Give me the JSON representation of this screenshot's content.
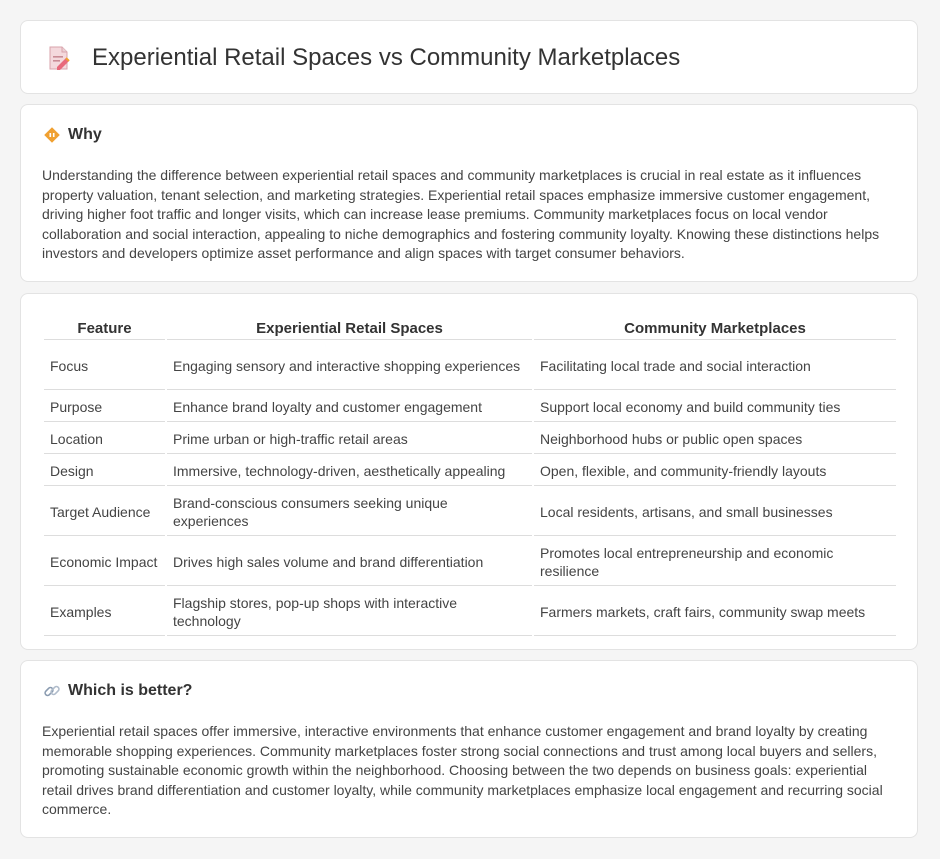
{
  "header": {
    "title": "Experiential Retail Spaces vs Community Marketplaces",
    "icon": "document-pencil-icon"
  },
  "why": {
    "heading": "Why",
    "icon": "diamond-sign-icon",
    "text": "Understanding the difference between experiential retail spaces and community marketplaces is crucial in real estate as it influences property valuation, tenant selection, and marketing strategies. Experiential retail spaces emphasize immersive customer engagement, driving higher foot traffic and longer visits, which can increase lease premiums. Community marketplaces focus on local vendor collaboration and social interaction, appealing to niche demographics and fostering community loyalty. Knowing these distinctions helps investors and developers optimize asset performance and align spaces with target consumer behaviors."
  },
  "comparison": {
    "headers": [
      "Feature",
      "Experiential Retail Spaces",
      "Community Marketplaces"
    ],
    "rows": [
      [
        "Focus",
        "Engaging sensory and interactive shopping experiences",
        "Facilitating local trade and social interaction"
      ],
      [
        "Purpose",
        "Enhance brand loyalty and customer engagement",
        "Support local economy and build community ties"
      ],
      [
        "Location",
        "Prime urban or high-traffic retail areas",
        "Neighborhood hubs or public open spaces"
      ],
      [
        "Design",
        "Immersive, technology-driven, aesthetically appealing",
        "Open, flexible, and community-friendly layouts"
      ],
      [
        "Target Audience",
        "Brand-conscious consumers seeking unique experiences",
        "Local residents, artisans, and small businesses"
      ],
      [
        "Economic Impact",
        "Drives high sales volume and brand differentiation",
        "Promotes local entrepreneurship and economic resilience"
      ],
      [
        "Examples",
        "Flagship stores, pop-up shops with interactive technology",
        "Farmers markets, craft fairs, community swap meets"
      ]
    ]
  },
  "better": {
    "heading": "Which is better?",
    "icon": "link-icon",
    "text": "Experiential retail spaces offer immersive, interactive environments that enhance customer engagement and brand loyalty by creating memorable shopping experiences. Community marketplaces foster strong social connections and trust among local buyers and sellers, promoting sustainable economic growth within the neighborhood. Choosing between the two depends on business goals: experiential retail drives brand differentiation and customer loyalty, while community marketplaces emphasize local engagement and recurring social commerce."
  },
  "colors": {
    "background": "#f5f5f5",
    "card": "#ffffff",
    "accent_orange": "#f0a030",
    "icon_pink": "#e8697b"
  }
}
